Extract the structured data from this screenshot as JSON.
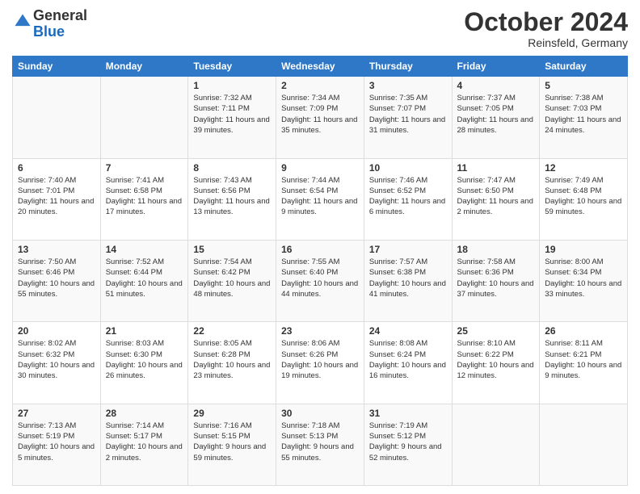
{
  "logo": {
    "general": "General",
    "blue": "Blue"
  },
  "header": {
    "month": "October 2024",
    "location": "Reinsfeld, Germany"
  },
  "days_of_week": [
    "Sunday",
    "Monday",
    "Tuesday",
    "Wednesday",
    "Thursday",
    "Friday",
    "Saturday"
  ],
  "weeks": [
    [
      {
        "day": "",
        "sunrise": "",
        "sunset": "",
        "daylight": ""
      },
      {
        "day": "",
        "sunrise": "",
        "sunset": "",
        "daylight": ""
      },
      {
        "day": "1",
        "sunrise": "Sunrise: 7:32 AM",
        "sunset": "Sunset: 7:11 PM",
        "daylight": "Daylight: 11 hours and 39 minutes."
      },
      {
        "day": "2",
        "sunrise": "Sunrise: 7:34 AM",
        "sunset": "Sunset: 7:09 PM",
        "daylight": "Daylight: 11 hours and 35 minutes."
      },
      {
        "day": "3",
        "sunrise": "Sunrise: 7:35 AM",
        "sunset": "Sunset: 7:07 PM",
        "daylight": "Daylight: 11 hours and 31 minutes."
      },
      {
        "day": "4",
        "sunrise": "Sunrise: 7:37 AM",
        "sunset": "Sunset: 7:05 PM",
        "daylight": "Daylight: 11 hours and 28 minutes."
      },
      {
        "day": "5",
        "sunrise": "Sunrise: 7:38 AM",
        "sunset": "Sunset: 7:03 PM",
        "daylight": "Daylight: 11 hours and 24 minutes."
      }
    ],
    [
      {
        "day": "6",
        "sunrise": "Sunrise: 7:40 AM",
        "sunset": "Sunset: 7:01 PM",
        "daylight": "Daylight: 11 hours and 20 minutes."
      },
      {
        "day": "7",
        "sunrise": "Sunrise: 7:41 AM",
        "sunset": "Sunset: 6:58 PM",
        "daylight": "Daylight: 11 hours and 17 minutes."
      },
      {
        "day": "8",
        "sunrise": "Sunrise: 7:43 AM",
        "sunset": "Sunset: 6:56 PM",
        "daylight": "Daylight: 11 hours and 13 minutes."
      },
      {
        "day": "9",
        "sunrise": "Sunrise: 7:44 AM",
        "sunset": "Sunset: 6:54 PM",
        "daylight": "Daylight: 11 hours and 9 minutes."
      },
      {
        "day": "10",
        "sunrise": "Sunrise: 7:46 AM",
        "sunset": "Sunset: 6:52 PM",
        "daylight": "Daylight: 11 hours and 6 minutes."
      },
      {
        "day": "11",
        "sunrise": "Sunrise: 7:47 AM",
        "sunset": "Sunset: 6:50 PM",
        "daylight": "Daylight: 11 hours and 2 minutes."
      },
      {
        "day": "12",
        "sunrise": "Sunrise: 7:49 AM",
        "sunset": "Sunset: 6:48 PM",
        "daylight": "Daylight: 10 hours and 59 minutes."
      }
    ],
    [
      {
        "day": "13",
        "sunrise": "Sunrise: 7:50 AM",
        "sunset": "Sunset: 6:46 PM",
        "daylight": "Daylight: 10 hours and 55 minutes."
      },
      {
        "day": "14",
        "sunrise": "Sunrise: 7:52 AM",
        "sunset": "Sunset: 6:44 PM",
        "daylight": "Daylight: 10 hours and 51 minutes."
      },
      {
        "day": "15",
        "sunrise": "Sunrise: 7:54 AM",
        "sunset": "Sunset: 6:42 PM",
        "daylight": "Daylight: 10 hours and 48 minutes."
      },
      {
        "day": "16",
        "sunrise": "Sunrise: 7:55 AM",
        "sunset": "Sunset: 6:40 PM",
        "daylight": "Daylight: 10 hours and 44 minutes."
      },
      {
        "day": "17",
        "sunrise": "Sunrise: 7:57 AM",
        "sunset": "Sunset: 6:38 PM",
        "daylight": "Daylight: 10 hours and 41 minutes."
      },
      {
        "day": "18",
        "sunrise": "Sunrise: 7:58 AM",
        "sunset": "Sunset: 6:36 PM",
        "daylight": "Daylight: 10 hours and 37 minutes."
      },
      {
        "day": "19",
        "sunrise": "Sunrise: 8:00 AM",
        "sunset": "Sunset: 6:34 PM",
        "daylight": "Daylight: 10 hours and 33 minutes."
      }
    ],
    [
      {
        "day": "20",
        "sunrise": "Sunrise: 8:02 AM",
        "sunset": "Sunset: 6:32 PM",
        "daylight": "Daylight: 10 hours and 30 minutes."
      },
      {
        "day": "21",
        "sunrise": "Sunrise: 8:03 AM",
        "sunset": "Sunset: 6:30 PM",
        "daylight": "Daylight: 10 hours and 26 minutes."
      },
      {
        "day": "22",
        "sunrise": "Sunrise: 8:05 AM",
        "sunset": "Sunset: 6:28 PM",
        "daylight": "Daylight: 10 hours and 23 minutes."
      },
      {
        "day": "23",
        "sunrise": "Sunrise: 8:06 AM",
        "sunset": "Sunset: 6:26 PM",
        "daylight": "Daylight: 10 hours and 19 minutes."
      },
      {
        "day": "24",
        "sunrise": "Sunrise: 8:08 AM",
        "sunset": "Sunset: 6:24 PM",
        "daylight": "Daylight: 10 hours and 16 minutes."
      },
      {
        "day": "25",
        "sunrise": "Sunrise: 8:10 AM",
        "sunset": "Sunset: 6:22 PM",
        "daylight": "Daylight: 10 hours and 12 minutes."
      },
      {
        "day": "26",
        "sunrise": "Sunrise: 8:11 AM",
        "sunset": "Sunset: 6:21 PM",
        "daylight": "Daylight: 10 hours and 9 minutes."
      }
    ],
    [
      {
        "day": "27",
        "sunrise": "Sunrise: 7:13 AM",
        "sunset": "Sunset: 5:19 PM",
        "daylight": "Daylight: 10 hours and 5 minutes."
      },
      {
        "day": "28",
        "sunrise": "Sunrise: 7:14 AM",
        "sunset": "Sunset: 5:17 PM",
        "daylight": "Daylight: 10 hours and 2 minutes."
      },
      {
        "day": "29",
        "sunrise": "Sunrise: 7:16 AM",
        "sunset": "Sunset: 5:15 PM",
        "daylight": "Daylight: 9 hours and 59 minutes."
      },
      {
        "day": "30",
        "sunrise": "Sunrise: 7:18 AM",
        "sunset": "Sunset: 5:13 PM",
        "daylight": "Daylight: 9 hours and 55 minutes."
      },
      {
        "day": "31",
        "sunrise": "Sunrise: 7:19 AM",
        "sunset": "Sunset: 5:12 PM",
        "daylight": "Daylight: 9 hours and 52 minutes."
      },
      {
        "day": "",
        "sunrise": "",
        "sunset": "",
        "daylight": ""
      },
      {
        "day": "",
        "sunrise": "",
        "sunset": "",
        "daylight": ""
      }
    ]
  ]
}
